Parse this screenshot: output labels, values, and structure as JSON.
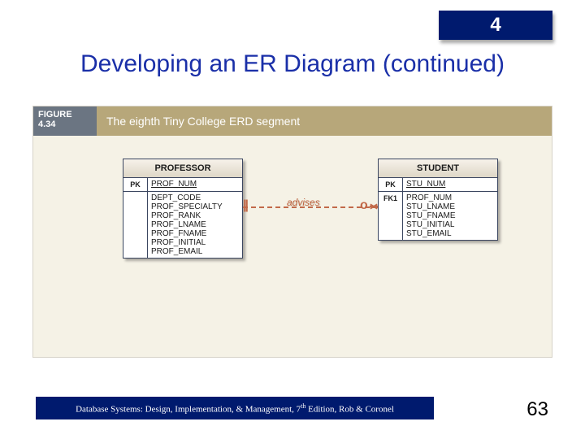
{
  "chapter_number": "4",
  "title": "Developing an ER Diagram (continued)",
  "figure": {
    "label_prefix": "FIGURE",
    "number": "4.34",
    "caption": "The eighth Tiny College ERD segment",
    "relationship_label": "advises",
    "entities": {
      "professor": {
        "name": "PROFESSOR",
        "pk_label": "PK",
        "pk_attr": "PROF_NUM",
        "attrs": [
          "DEPT_CODE",
          "PROF_SPECIALTY",
          "PROF_RANK",
          "PROF_LNAME",
          "PROF_FNAME",
          "PROF_INITIAL",
          "PROF_EMAIL"
        ]
      },
      "student": {
        "name": "STUDENT",
        "pk_label": "PK",
        "pk_attr": "STU_NUM",
        "fk_label": "FK1",
        "fk_attr": "PROF_NUM",
        "attrs": [
          "STU_LNAME",
          "STU_FNAME",
          "STU_INITIAL",
          "STU_EMAIL"
        ]
      }
    }
  },
  "footer": {
    "text_before_sup": "Database Systems: Design, Implementation, & Management, 7",
    "sup": "th",
    "text_after_sup": " Edition, Rob & Coronel"
  },
  "page_number": "63"
}
